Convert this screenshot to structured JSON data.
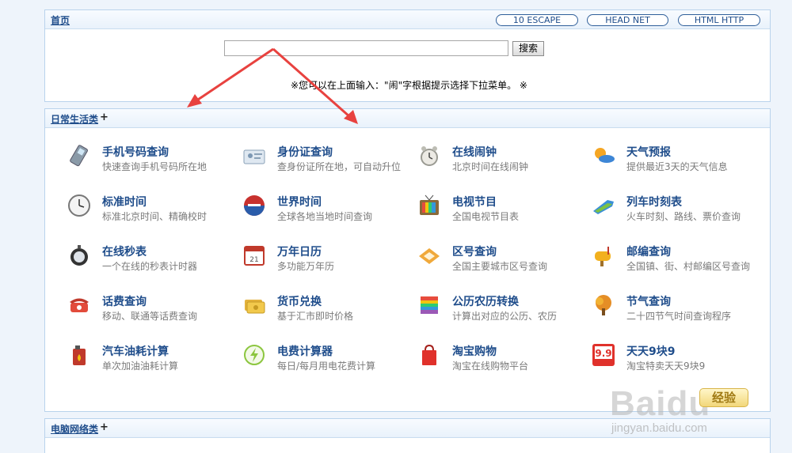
{
  "top": {
    "home_link": "首页",
    "pills": [
      "10 ESCAPE",
      "HEAD NET",
      "HTML HTTP"
    ],
    "search_placeholder": "",
    "search_button": "搜索",
    "hint": "※您可以在上面输入：\"闹\"字根据提示选择下拉菜单。 ※"
  },
  "daily": {
    "title": "日常生活类",
    "plus": "+",
    "items": [
      {
        "title": "手机号码查询",
        "desc": "快速查询手机号码所在地",
        "icon": "phone-icon"
      },
      {
        "title": "身份证查询",
        "desc": "查身份证所在地，可自动升位",
        "icon": "id-card-icon"
      },
      {
        "title": "在线闹钟",
        "desc": "北京时间在线闹钟",
        "icon": "alarm-clock-icon"
      },
      {
        "title": "天气预报",
        "desc": "提供最近3天的天气信息",
        "icon": "weather-icon"
      },
      {
        "title": "标准时间",
        "desc": "标准北京时间、精确校时",
        "icon": "clock-icon"
      },
      {
        "title": "世界时间",
        "desc": "全球各地当地时间查询",
        "icon": "globe-clock-icon"
      },
      {
        "title": "电视节目",
        "desc": "全国电视节目表",
        "icon": "tv-icon"
      },
      {
        "title": "列车时刻表",
        "desc": "火车时刻、路线、票价查询",
        "icon": "train-icon"
      },
      {
        "title": "在线秒表",
        "desc": "一个在线的秒表计时器",
        "icon": "stopwatch-icon"
      },
      {
        "title": "万年日历",
        "desc": "多功能万年历",
        "icon": "calendar-icon"
      },
      {
        "title": "区号查询",
        "desc": "全国主要城市区号查询",
        "icon": "area-code-icon"
      },
      {
        "title": "邮编查询",
        "desc": "全国镇、街、村邮编区号查询",
        "icon": "mailbox-icon"
      },
      {
        "title": "话费查询",
        "desc": "移动、联通等话费查询",
        "icon": "telephone-icon"
      },
      {
        "title": "货币兑换",
        "desc": "基于汇市即时价格",
        "icon": "currency-icon"
      },
      {
        "title": "公历农历转换",
        "desc": "计算出对应的公历、农历",
        "icon": "lunar-calendar-icon"
      },
      {
        "title": "节气查询",
        "desc": "二十四节气时间查询程序",
        "icon": "tree-icon"
      },
      {
        "title": "汽车油耗计算",
        "desc": "单次加油油耗计算",
        "icon": "fuel-can-icon"
      },
      {
        "title": "电费计算器",
        "desc": "每日/每月用电花费计算",
        "icon": "electricity-icon"
      },
      {
        "title": "淘宝购物",
        "desc": "淘宝在线购物平台",
        "icon": "shopping-bag-icon"
      },
      {
        "title": "天天9块9",
        "desc": "淘宝特卖天天9块9",
        "icon": "nine-nine-icon"
      }
    ]
  },
  "network": {
    "title": "电脑网络类",
    "plus": "+"
  },
  "watermark": {
    "logo": "Baidu",
    "sub": "jingyan.baidu.com",
    "stamp": "经验"
  },
  "colors": {
    "link": "#1f4d8b",
    "arrow": "#e8423f",
    "border": "#b9d3ec"
  }
}
